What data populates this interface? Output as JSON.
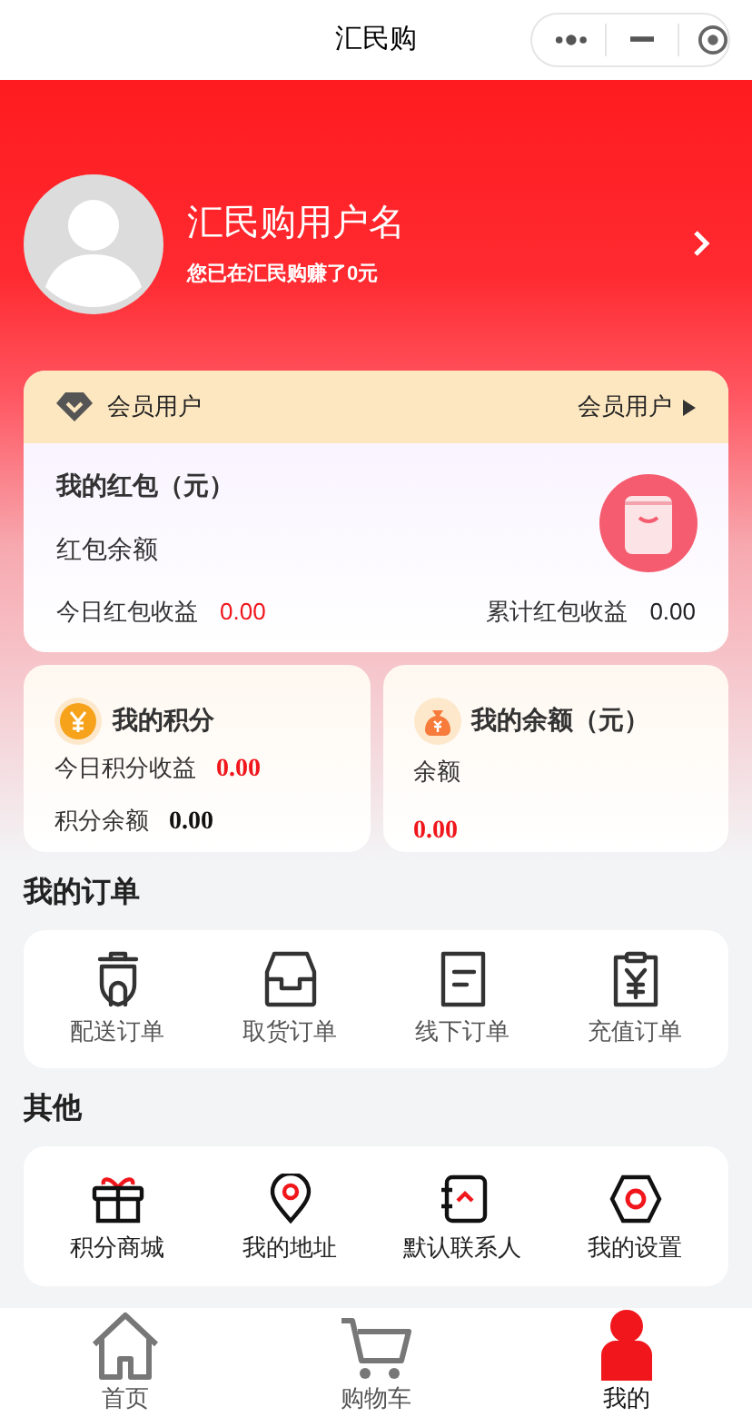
{
  "nav_bar": {
    "title": "汇民购"
  },
  "profile": {
    "username": "汇民购用户名",
    "subtitle": "您已在汇民购赚了0元"
  },
  "member_card": {
    "badge_label": "会员用户",
    "level_link": "会员用户",
    "title": "我的红包（元）",
    "balance_label": "红包余额",
    "today_label": "今日红包收益",
    "today_value": "0.00",
    "total_label": "累计红包收益",
    "total_value": "0.00"
  },
  "points_card": {
    "title": "我的积分",
    "today_label": "今日积分收益",
    "today_value": "0.00",
    "balance_label": "积分余额",
    "balance_value": "0.00"
  },
  "balance_card": {
    "title": "我的余额（元）",
    "balance_label": "余额",
    "balance_value": "0.00"
  },
  "orders": {
    "heading": "我的订单",
    "items": [
      {
        "kind": "delivery",
        "label": "配送订单"
      },
      {
        "kind": "pickup",
        "label": "取货订单"
      },
      {
        "kind": "offline",
        "label": "线下订单"
      },
      {
        "kind": "recharge",
        "label": "充值订单"
      }
    ]
  },
  "others": {
    "heading": "其他",
    "items": [
      {
        "kind": "gift",
        "label": "积分商城"
      },
      {
        "kind": "location",
        "label": "我的地址"
      },
      {
        "kind": "contact",
        "label": "默认联系人"
      },
      {
        "kind": "settings",
        "label": "我的设置"
      }
    ]
  },
  "tab_bar": [
    {
      "kind": "home",
      "label": "首页",
      "selected": false
    },
    {
      "kind": "cart",
      "label": "购物车",
      "selected": false
    },
    {
      "kind": "user",
      "label": "我的",
      "selected": true
    }
  ]
}
